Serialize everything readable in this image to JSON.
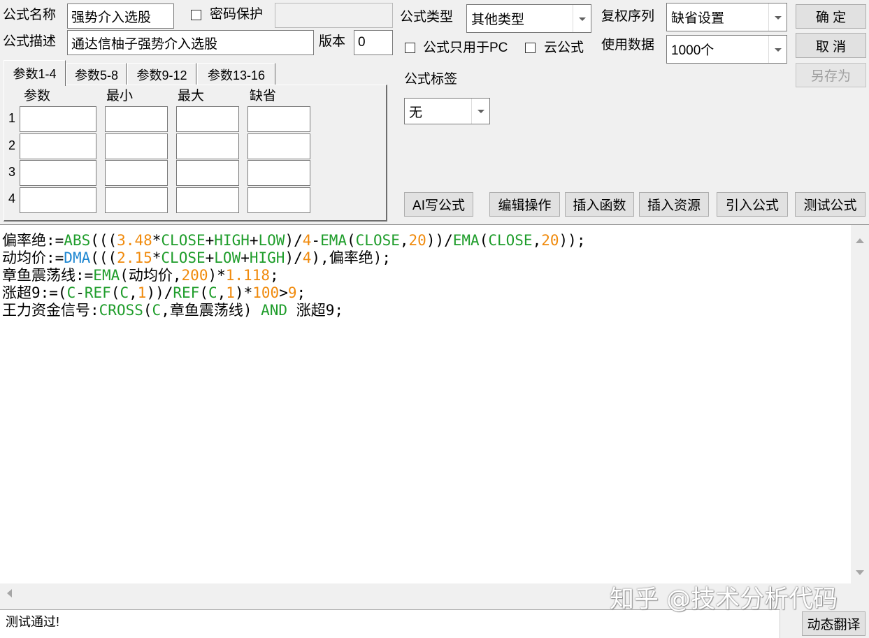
{
  "form": {
    "name_label": "公式名称",
    "name_value": "强势介入选股",
    "password_label": "密码保护",
    "password_protected": false,
    "password_value": "",
    "type_label": "公式类型",
    "type_value": "其他类型",
    "adjust_label": "复权序列",
    "adjust_value": "缺省设置",
    "desc_label": "公式描述",
    "desc_value": "通达信柚子强势介入选股",
    "version_label": "版本",
    "version_value": "0",
    "pc_only_label": "公式只用于PC",
    "pc_only": false,
    "cloud_label": "云公式",
    "cloud": false,
    "data_label": "使用数据",
    "data_value": "1000个",
    "tag_label": "公式标签",
    "tag_value": "无"
  },
  "buttons": {
    "ok": "确 定",
    "cancel": "取 消",
    "save_as": "另存为",
    "ai_write": "AI写公式",
    "edit_ops": "编辑操作",
    "insert_function": "插入函数",
    "insert_resource": "插入资源",
    "import_formula": "引入公式",
    "test_formula": "测试公式",
    "dynamic_translate": "动态翻译"
  },
  "params": {
    "tabs": [
      "参数1-4",
      "参数5-8",
      "参数9-12",
      "参数13-16"
    ],
    "active_tab": 0,
    "headers": [
      "参数",
      "最小",
      "最大",
      "缺省"
    ],
    "rows": [
      {
        "index": "1",
        "values": [
          "",
          "",
          "",
          ""
        ]
      },
      {
        "index": "2",
        "values": [
          "",
          "",
          "",
          ""
        ]
      },
      {
        "index": "3",
        "values": [
          "",
          "",
          "",
          ""
        ]
      },
      {
        "index": "4",
        "values": [
          "",
          "",
          "",
          ""
        ]
      }
    ]
  },
  "editor": {
    "lines": [
      [
        [
          "偏率绝:=",
          "#000000"
        ],
        [
          "ABS",
          "#1f9d2b"
        ],
        [
          "(((",
          "#000000"
        ],
        [
          "3.48",
          "#f08a0c"
        ],
        [
          "*",
          "#000000"
        ],
        [
          "CLOSE",
          "#1f9d2b"
        ],
        [
          "+",
          "#000000"
        ],
        [
          "HIGH",
          "#1f9d2b"
        ],
        [
          "+",
          "#000000"
        ],
        [
          "LOW",
          "#1f9d2b"
        ],
        [
          ")/",
          "#000000"
        ],
        [
          "4",
          "#f08a0c"
        ],
        [
          "-",
          "#000000"
        ],
        [
          "EMA",
          "#1f9d2b"
        ],
        [
          "(",
          "#000000"
        ],
        [
          "CLOSE",
          "#1f9d2b"
        ],
        [
          ",",
          "#000000"
        ],
        [
          "20",
          "#f08a0c"
        ],
        [
          "))/",
          "#000000"
        ],
        [
          "EMA",
          "#1f9d2b"
        ],
        [
          "(",
          "#000000"
        ],
        [
          "CLOSE",
          "#1f9d2b"
        ],
        [
          ",",
          "#000000"
        ],
        [
          "20",
          "#f08a0c"
        ],
        [
          "));",
          "#000000"
        ]
      ],
      [
        [
          "动均价:=",
          "#000000"
        ],
        [
          "DMA",
          "#1d86d1"
        ],
        [
          "(((",
          "#000000"
        ],
        [
          "2.15",
          "#f08a0c"
        ],
        [
          "*",
          "#000000"
        ],
        [
          "CLOSE",
          "#1f9d2b"
        ],
        [
          "+",
          "#000000"
        ],
        [
          "LOW",
          "#1f9d2b"
        ],
        [
          "+",
          "#000000"
        ],
        [
          "HIGH",
          "#1f9d2b"
        ],
        [
          ")/",
          "#000000"
        ],
        [
          "4",
          "#f08a0c"
        ],
        [
          "),偏率绝);",
          "#000000"
        ]
      ],
      [
        [
          "章鱼震荡线:=",
          "#000000"
        ],
        [
          "EMA",
          "#1f9d2b"
        ],
        [
          "(动均价,",
          "#000000"
        ],
        [
          "200",
          "#f08a0c"
        ],
        [
          ")*",
          "#000000"
        ],
        [
          "1.118",
          "#f08a0c"
        ],
        [
          ";",
          "#000000"
        ]
      ],
      [
        [
          "涨超9:=(",
          "#000000"
        ],
        [
          "C",
          "#1f9d2b"
        ],
        [
          "-",
          "#000000"
        ],
        [
          "REF",
          "#1f9d2b"
        ],
        [
          "(",
          "#000000"
        ],
        [
          "C",
          "#1f9d2b"
        ],
        [
          ",",
          "#000000"
        ],
        [
          "1",
          "#f08a0c"
        ],
        [
          "))/",
          "#000000"
        ],
        [
          "REF",
          "#1f9d2b"
        ],
        [
          "(",
          "#000000"
        ],
        [
          "C",
          "#1f9d2b"
        ],
        [
          ",",
          "#000000"
        ],
        [
          "1",
          "#f08a0c"
        ],
        [
          ")*",
          "#000000"
        ],
        [
          "100",
          "#f08a0c"
        ],
        [
          ">",
          "#000000"
        ],
        [
          "9",
          "#f08a0c"
        ],
        [
          ";",
          "#000000"
        ]
      ],
      [
        [
          "王力资金信号:",
          "#000000"
        ],
        [
          "CROSS",
          "#1f9d2b"
        ],
        [
          "(",
          "#000000"
        ],
        [
          "C",
          "#1f9d2b"
        ],
        [
          ",章鱼震荡线) ",
          "#000000"
        ],
        [
          "AND",
          "#1f9d2b"
        ],
        [
          " 涨超9;",
          "#000000"
        ]
      ]
    ]
  },
  "status": {
    "message": "测试通过!"
  },
  "watermark": {
    "text": "知乎 @技术分析代码"
  }
}
